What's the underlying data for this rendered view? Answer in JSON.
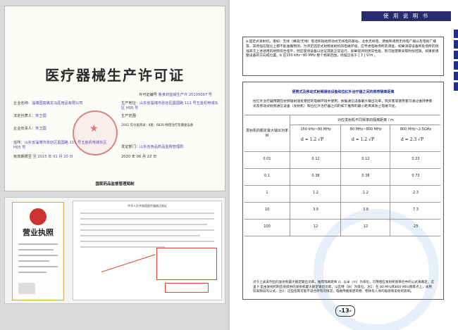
{
  "left": {
    "license": {
      "title": "医疗器械生产许可证",
      "cert_no_label": "许可证编号",
      "cert_no": "鲁食药监械生产许 20100097 号",
      "company_label": "企业名称",
      "company": "淄博国富鑫龙马医用品有限公司",
      "address_label": "住所",
      "address": "山东省淄博市张店区昌国路 111 号五金机电城东区 H05 号",
      "legal_label": "法定代表人",
      "legal": "宋卫国",
      "head_label": "企业负责人",
      "head": "宋卫国",
      "prod_addr_label": "生产地址",
      "prod_addr": "山东省淄博市张店区昌国路 111 号五金机电城东区 H05 号",
      "scope_label": "生产范围",
      "scope": "2002 年分类目录：Ⅱ类：6826-物理治疗及康复设备",
      "date_label": "发证部门",
      "date_prefix": "有效期限至",
      "issuer": "山东省食品药品监督管理局",
      "expire": "至 2025 年 01 月 20 日",
      "issue_date": "2020 年 06 月 22 日",
      "footer": "国家药品监督管理局制"
    },
    "business_license": {
      "title": "营业执照"
    },
    "scan": {
      "header": "中华人民共和国医疗器械注册证"
    }
  },
  "right": {
    "header": "使 用 说 明 书",
    "intro": "a  固定式发射机，诸如：无线（蜂窝/无绳）电话和陆地移动式无线电的基站、业余无线电、调幅和调频无线电广播以及电视广播等，其场强在理论上都不能准确预测。为评定固定式射频发射机的电磁环境，应考虑电磁场所的调查。如果测得设备所处场所的场强高于上述适用的射频符合电平，则应观测设备以验证其能正常运行。如果观测到异常性能，则可能需要采取附加措施，如重新调整设备的方向或位置。b 在150 kHz~80 MHz 整个频率范围，场强应低于 [ 3 ] V/m 。",
    "table_title": "便携式及移动式射频通信设备和拉红外治疗器之间的推荐隔离距离",
    "table_intro": "拉红外治疗器预期在射频辐射骚扰受控的电磁环境中使用。依据通信设备最大输出功率，购买者或使用者可通过维持便携式及移动式射频通信设备（发射机）和拉红外治疗器之间的如下推荐的最小距离来防止电磁干扰。",
    "col_header_left": "发射机的额定最大输出功率 W",
    "col_header_top": "对应发射机不同频率的隔离距离 / m",
    "freq1": "150 kHz~80 MHz",
    "freq2": "80 MHz~800 MHz",
    "freq3": "800 MHz~2.5GHz",
    "formula1": "d = 1.2 √P",
    "formula2": "d = 1.2 √P",
    "formula3": "d = 2.3 √P",
    "rows": [
      [
        "0.01",
        "0.12",
        "0.12",
        "0.23"
      ],
      [
        "0.1",
        "0.38",
        "0.38",
        "0.73"
      ],
      [
        "1",
        "1.2",
        "1.2",
        "2.3"
      ],
      [
        "10",
        "3.8",
        "3.8",
        "7.3"
      ],
      [
        "100",
        "12",
        "12",
        "23"
      ]
    ],
    "notes": "对于上表未列出的发射机最大额定输出功率，推荐隔离距离 d，以米（m）为单位，可用相应发射机频率栏中的公式来确定，这里 P 是由发射机制造商提供的发射机最大额定输出功率，以瓦特（W）为单位。注1：在 80 MHz和800 MHz频率点上，采用较高频段的公式。注2：这些指南可能不适合所有的情况，电磁传播受建筑物、物体及人体的吸收和反射的影响。",
    "page_number": "-13-"
  }
}
